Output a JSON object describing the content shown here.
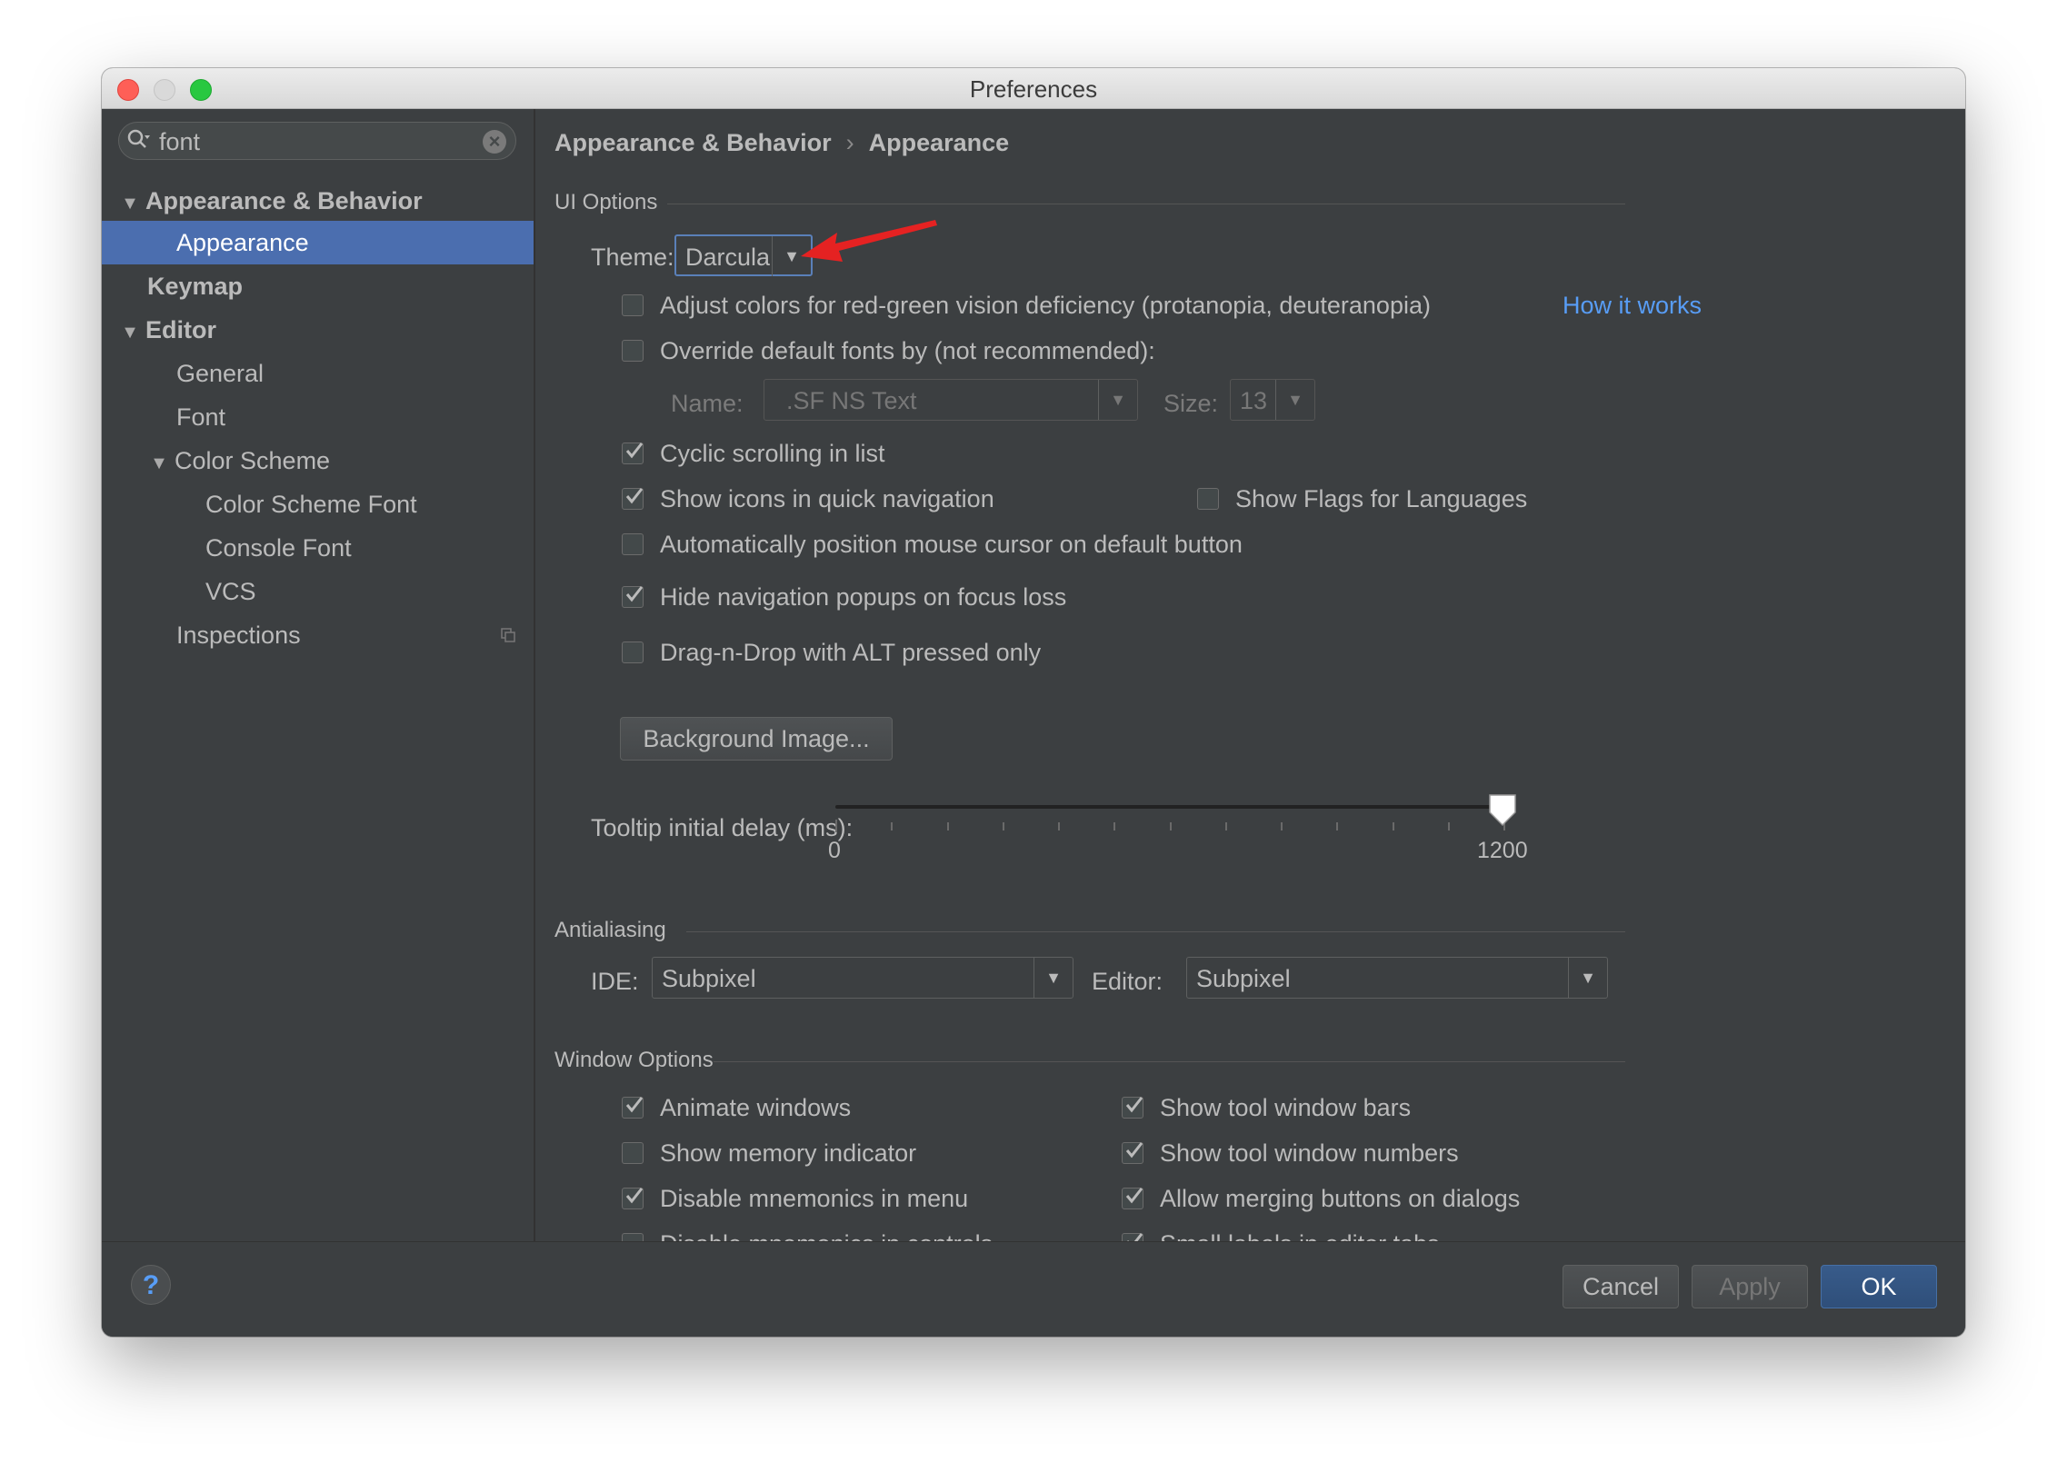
{
  "window": {
    "title": "Preferences"
  },
  "search": {
    "value": "font"
  },
  "sidebar": {
    "items": [
      {
        "label": "Appearance & Behavior"
      },
      {
        "label": "Appearance"
      },
      {
        "label": "Keymap"
      },
      {
        "label": "Editor"
      },
      {
        "label": "General"
      },
      {
        "label": "Font"
      },
      {
        "label": "Color Scheme"
      },
      {
        "label": "Color Scheme Font"
      },
      {
        "label": "Console Font"
      },
      {
        "label": "VCS"
      },
      {
        "label": "Inspections"
      }
    ]
  },
  "breadcrumb": {
    "parent": "Appearance & Behavior",
    "separator": "›",
    "current": "Appearance"
  },
  "ui_options": {
    "title": "UI Options",
    "theme_label": "Theme:",
    "theme_value": "Darcula",
    "adjust_colors": {
      "label": "Adjust colors for red-green vision deficiency (protanopia, deuteranopia)",
      "checked": false
    },
    "how_it_works": "How it works",
    "override_fonts": {
      "label": "Override default fonts by (not recommended):",
      "checked": false
    },
    "font_name_label": "Name:",
    "font_name_value": ".SF NS Text",
    "font_size_label": "Size:",
    "font_size_value": "13",
    "cyclic_scrolling": {
      "label": "Cyclic scrolling in list",
      "checked": true
    },
    "show_icons": {
      "label": "Show icons in quick navigation",
      "checked": true
    },
    "show_flags": {
      "label": "Show Flags for Languages",
      "checked": false
    },
    "auto_mouse": {
      "label": "Automatically position mouse cursor on default button",
      "checked": false
    },
    "hide_popups": {
      "label": "Hide navigation popups on focus loss",
      "checked": true
    },
    "drag_drop": {
      "label": "Drag-n-Drop with ALT pressed only",
      "checked": false
    },
    "background_image_button": "Background Image...",
    "tooltip_label": "Tooltip initial delay (ms):",
    "tooltip_min": "0",
    "tooltip_max": "1200",
    "tooltip_value": 1200
  },
  "antialiasing": {
    "title": "Antialiasing",
    "ide_label": "IDE:",
    "ide_value": "Subpixel",
    "editor_label": "Editor:",
    "editor_value": "Subpixel"
  },
  "window_options": {
    "title": "Window Options",
    "animate_windows": {
      "label": "Animate windows",
      "checked": true
    },
    "show_memory": {
      "label": "Show memory indicator",
      "checked": false
    },
    "disable_mnemonics_menu": {
      "label": "Disable mnemonics in menu",
      "checked": true
    },
    "disable_mnemonics_controls": {
      "label": "Disable mnemonics in controls",
      "checked": false
    },
    "show_tool_bars": {
      "label": "Show tool window bars",
      "checked": true
    },
    "show_tool_numbers": {
      "label": "Show tool window numbers",
      "checked": true
    },
    "allow_merging": {
      "label": "Allow merging buttons on dialogs",
      "checked": true
    },
    "small_labels": {
      "label": "Small labels in editor tabs",
      "checked": true
    }
  },
  "footer": {
    "help_icon": "?",
    "cancel": "Cancel",
    "apply": "Apply",
    "ok": "OK"
  },
  "colors": {
    "background": "#3c3f41",
    "selection": "#4b6eaf",
    "link": "#589df6",
    "annotation_arrow": "#e52222"
  }
}
